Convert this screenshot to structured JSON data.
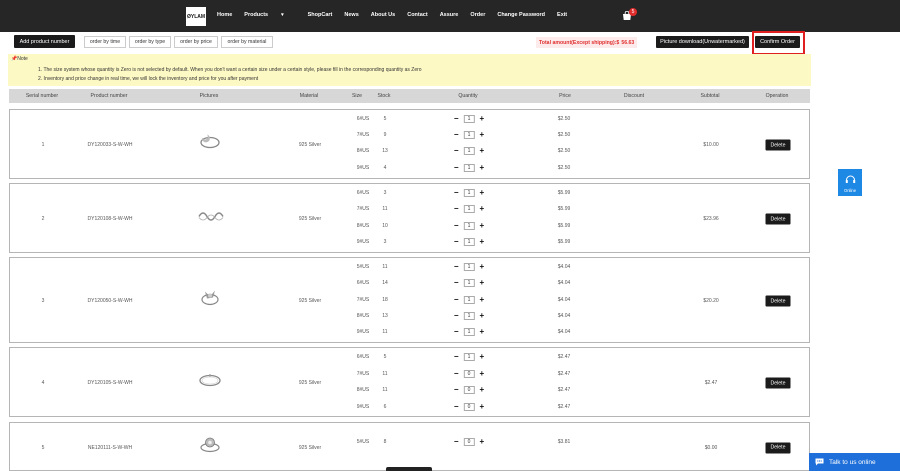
{
  "nav": {
    "logo": "ØYLAM",
    "links": [
      "Home",
      "Products",
      "ShopCart",
      "News",
      "About Us",
      "Contact",
      "Assure",
      "Order",
      "Change Password",
      "Exit"
    ],
    "cart_count": "5"
  },
  "toolbar": {
    "add_product": "Add product number",
    "sort_buttons": [
      "order by time",
      "order by type",
      "order by price",
      "order by material"
    ],
    "total_label": "Total amount(Except shipping):$",
    "total_value": "56.63",
    "picture_download": "Picture download(Unwatermarked)",
    "confirm_order": "Confirm Order"
  },
  "note": {
    "title": "Note",
    "line1": "1. The size system whose quantity is Zero is not selected by default. When you don't want a certain size under a certain style, please fill in the corresponding quantity as Zero",
    "line2": "2. Inventory and price change in real time, we will lock the inventory and price for you after payment"
  },
  "table": {
    "headers": [
      "Serial number",
      "Product number",
      "Pictures",
      "Material",
      "Size",
      "Stock",
      "Quantity",
      "Price",
      "Discount",
      "Subtotal",
      "Operation"
    ],
    "delete_label": "Delete",
    "products": [
      {
        "serial": "1",
        "number": "DY120033-S-W-WH",
        "material": "925 Silver",
        "subtotal": "$10.00",
        "ring": "ring-crescent",
        "sizes": [
          {
            "size": "6#US",
            "stock": "5",
            "qty": "1",
            "price": "$2.50"
          },
          {
            "size": "7#US",
            "stock": "9",
            "qty": "1",
            "price": "$2.50"
          },
          {
            "size": "8#US",
            "stock": "13",
            "qty": "1",
            "price": "$2.50"
          },
          {
            "size": "9#US",
            "stock": "4",
            "qty": "1",
            "price": "$2.50"
          }
        ]
      },
      {
        "serial": "2",
        "number": "DY120108-S-W-WH",
        "material": "925 Silver",
        "subtotal": "$23.96",
        "ring": "ring-wave",
        "sizes": [
          {
            "size": "6#US",
            "stock": "3",
            "qty": "1",
            "price": "$5.99"
          },
          {
            "size": "7#US",
            "stock": "11",
            "qty": "1",
            "price": "$5.99"
          },
          {
            "size": "8#US",
            "stock": "10",
            "qty": "1",
            "price": "$5.99"
          },
          {
            "size": "9#US",
            "stock": "3",
            "qty": "1",
            "price": "$5.99"
          }
        ]
      },
      {
        "serial": "3",
        "number": "DY120050-S-W-WH",
        "material": "925 Silver",
        "subtotal": "$20.20",
        "ring": "ring-leaf",
        "sizes": [
          {
            "size": "5#US",
            "stock": "11",
            "qty": "1",
            "price": "$4.04"
          },
          {
            "size": "6#US",
            "stock": "14",
            "qty": "1",
            "price": "$4.04"
          },
          {
            "size": "7#US",
            "stock": "18",
            "qty": "1",
            "price": "$4.04"
          },
          {
            "size": "8#US",
            "stock": "13",
            "qty": "1",
            "price": "$4.04"
          },
          {
            "size": "9#US",
            "stock": "11",
            "qty": "1",
            "price": "$4.04"
          }
        ]
      },
      {
        "serial": "4",
        "number": "DY120105-S-W-WH",
        "material": "925 Silver",
        "subtotal": "$2.47",
        "ring": "ring-band",
        "sizes": [
          {
            "size": "6#US",
            "stock": "5",
            "qty": "1",
            "price": "$2.47"
          },
          {
            "size": "7#US",
            "stock": "11",
            "qty": "0",
            "price": "$2.47"
          },
          {
            "size": "8#US",
            "stock": "11",
            "qty": "0",
            "price": "$2.47"
          },
          {
            "size": "9#US",
            "stock": "6",
            "qty": "0",
            "price": "$2.47"
          }
        ]
      },
      {
        "serial": "5",
        "number": "NE120111-S-W-WH",
        "material": "925 Silver",
        "subtotal": "$0.00",
        "ring": "ring-flower",
        "sizes": [
          {
            "size": "5#US",
            "stock": "8",
            "qty": "0",
            "price": "$3.81"
          }
        ]
      }
    ]
  },
  "widgets": {
    "online": "Online",
    "talk": "Talk to us online"
  },
  "colors": {
    "nav_bg": "#262626",
    "note_bg": "#fdf9c4",
    "header_bg": "#d7d7d7",
    "accent_red": "#e02020",
    "chat_blue": "#1e6fd9"
  }
}
